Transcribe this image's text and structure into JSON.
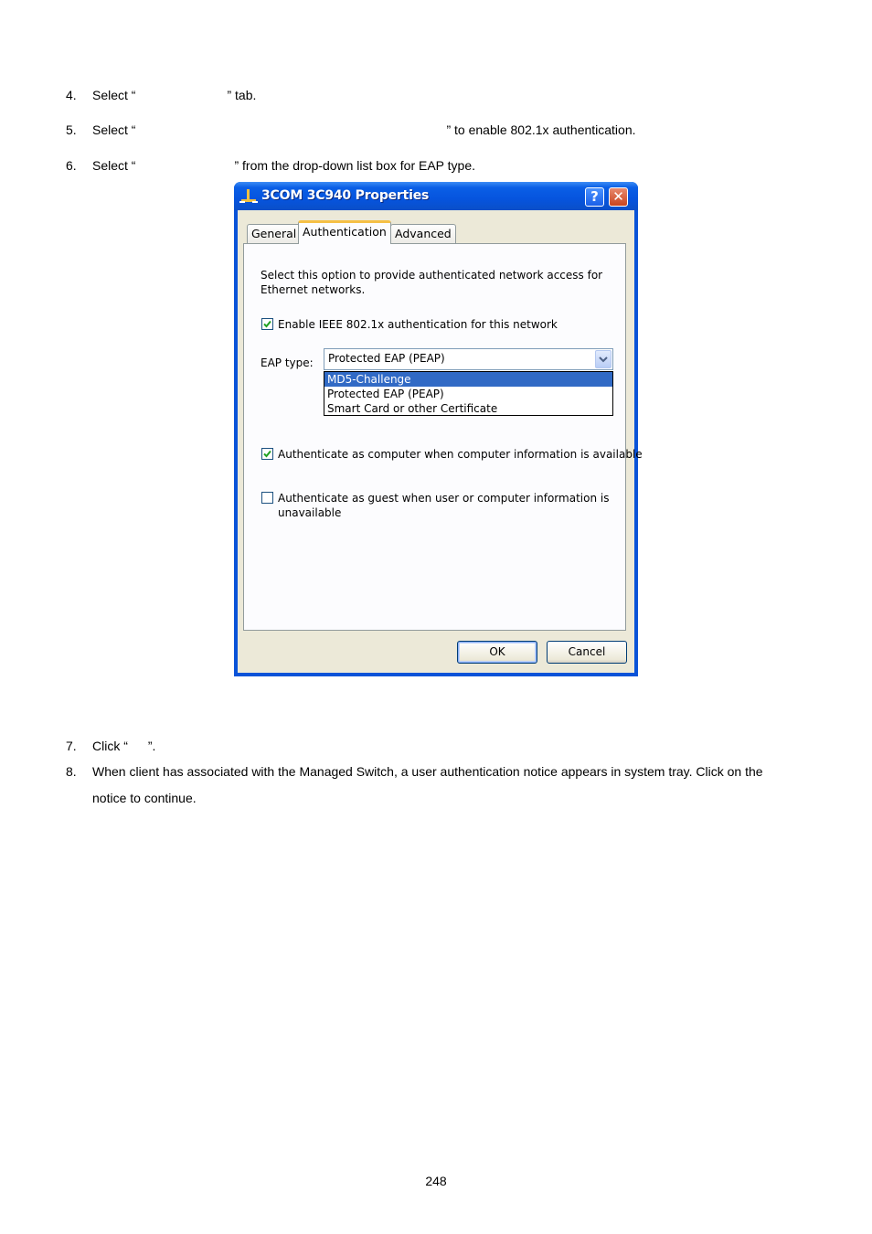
{
  "steps": {
    "s4": {
      "num": "4.",
      "before": "Select “",
      "after": "” tab."
    },
    "s5": {
      "num": "5.",
      "before": "Select “",
      "after": "” to enable 802.1x authentication."
    },
    "s6": {
      "num": "6.",
      "before": "Select “",
      "after": "” from the drop-down list box for EAP type."
    },
    "s7": {
      "num": "7.",
      "before": "Click “",
      "after": "”."
    },
    "s8": {
      "num": "8.",
      "line1": "When client has associated with the Managed Switch, a user authentication notice appears in system tray. Click on the",
      "line2": "notice to continue."
    }
  },
  "dialog": {
    "title": "3COM 3C940 Properties",
    "help_label": "?",
    "close_label": "✕",
    "tabs": [
      "General",
      "Authentication",
      "Advanced"
    ],
    "description_line1": "Select this option to provide authenticated network access for",
    "description_line2": "Ethernet networks.",
    "enable_8021x": {
      "label": "Enable IEEE 802.1x authentication for this network",
      "checked": true
    },
    "eap_label": "EAP type:",
    "eap_selected": "Protected EAP (PEAP)",
    "eap_options": [
      "MD5-Challenge",
      "Protected EAP (PEAP)",
      "Smart Card or other Certificate"
    ],
    "auth_computer": {
      "label": "Authenticate as computer when computer information is available",
      "checked": true
    },
    "auth_guest": {
      "label_line1": "Authenticate as guest when user or computer information is",
      "label_line2": "unavailable",
      "checked": false
    },
    "ok_label": "OK",
    "cancel_label": "Cancel"
  },
  "page_number": "248"
}
